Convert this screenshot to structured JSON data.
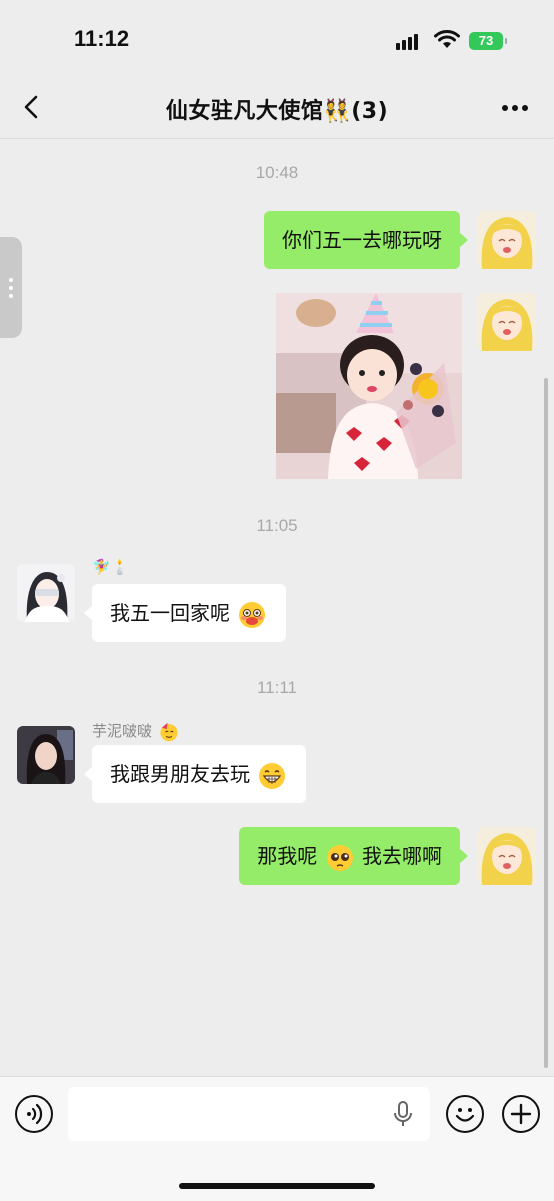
{
  "status_bar": {
    "time": "11:12",
    "battery": "73"
  },
  "header": {
    "title": "仙女驻凡大使馆👯(3)"
  },
  "messages": [
    {
      "type": "time",
      "text": "10:48"
    },
    {
      "type": "text",
      "direction": "outgoing",
      "text": "你们五一去哪玩呀"
    },
    {
      "type": "image",
      "direction": "outgoing",
      "description_icon": "sticker-girl-birthday-photo"
    },
    {
      "type": "time",
      "text": "11:05"
    },
    {
      "type": "text",
      "direction": "incoming",
      "sender": "🧚‍♀️🕯️",
      "text": "我五一回家呢"
    },
    {
      "type": "time",
      "text": "11:11"
    },
    {
      "type": "text",
      "direction": "incoming",
      "sender": "芋泥啵啵",
      "text": "我跟男朋友去玩"
    },
    {
      "type": "text",
      "direction": "outgoing",
      "text_before_emoji": "那我呢",
      "text_after_emoji": " 我去哪啊"
    }
  ],
  "icons": {
    "back": "back-chevron-icon",
    "more": "more-dots-icon",
    "voice": "voice-icon",
    "mic": "mic-icon",
    "emoji": "emoji-icon",
    "plus": "plus-icon"
  },
  "colors": {
    "outgoing_bubble": "#95ec69",
    "incoming_bubble": "#ffffff",
    "background": "#ededed"
  }
}
